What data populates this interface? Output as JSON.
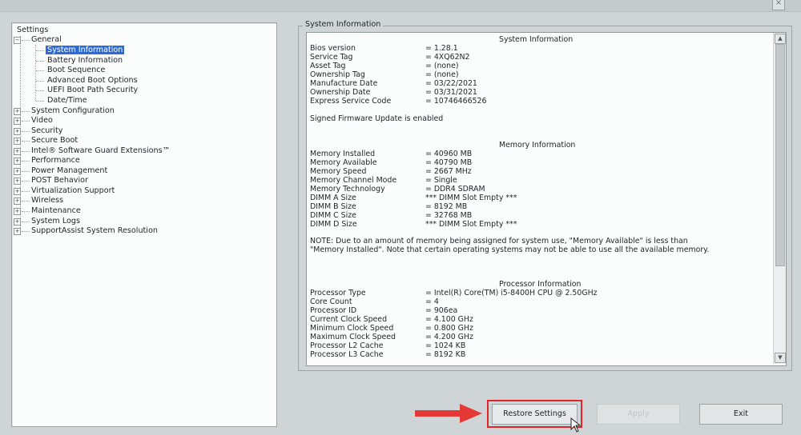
{
  "window": {
    "title": "",
    "close_symbol": "×"
  },
  "tree": {
    "root": "Settings",
    "general": {
      "label": "General",
      "children": [
        "System Information",
        "Battery Information",
        "Boot Sequence",
        "Advanced Boot Options",
        "UEFI Boot Path Security",
        "Date/Time"
      ]
    },
    "categories": [
      "System Configuration",
      "Video",
      "Security",
      "Secure Boot",
      "Intel® Software Guard Extensions™",
      "Performance",
      "Power Management",
      "POST Behavior",
      "Virtualization Support",
      "Wireless",
      "Maintenance",
      "System Logs",
      "SupportAssist System Resolution"
    ]
  },
  "panel": {
    "group_label": "System Information",
    "system": {
      "title": "System Information",
      "rows": [
        {
          "k": "Bios version",
          "v": "= 1.28.1"
        },
        {
          "k": "Service Tag",
          "v": "= 4XQ62N2"
        },
        {
          "k": "Asset Tag",
          "v": "= (none)"
        },
        {
          "k": "Ownership Tag",
          "v": "= (none)"
        },
        {
          "k": "Manufacture Date",
          "v": "= 03/22/2021"
        },
        {
          "k": "Ownership Date",
          "v": "= 03/31/2021"
        },
        {
          "k": "Express Service Code",
          "v": "= 10746466526"
        }
      ],
      "firmware_note": "Signed Firmware Update is enabled"
    },
    "memory": {
      "title": "Memory Information",
      "rows": [
        {
          "k": "Memory Installed",
          "v": "= 40960 MB"
        },
        {
          "k": "Memory Available",
          "v": "= 40790 MB"
        },
        {
          "k": "Memory Speed",
          "v": "= 2667 MHz"
        },
        {
          "k": "Memory Channel Mode",
          "v": "= Single"
        },
        {
          "k": "Memory Technology",
          "v": "= DDR4 SDRAM"
        },
        {
          "k": "DIMM A Size",
          "v": "*** DIMM Slot Empty ***"
        },
        {
          "k": "DIMM B Size",
          "v": "= 8192 MB"
        },
        {
          "k": "DIMM C Size",
          "v": "= 32768 MB"
        },
        {
          "k": "DIMM D Size",
          "v": "*** DIMM Slot Empty ***"
        }
      ],
      "note": "NOTE: Due to an amount of memory being assigned for system use, \"Memory Available\" is less than \"Memory Installed\". Note that certain operating systems may not be able to use all the available memory."
    },
    "processor": {
      "title": "Processor Information",
      "rows": [
        {
          "k": "Processor Type",
          "v": "= Intel(R) Core(TM) i5-8400H CPU @ 2.50GHz"
        },
        {
          "k": "Core Count",
          "v": "= 4"
        },
        {
          "k": "Processor ID",
          "v": "= 906ea"
        },
        {
          "k": "Current Clock Speed",
          "v": "= 4.100 GHz"
        },
        {
          "k": "Minimum Clock Speed",
          "v": "= 0.800 GHz"
        },
        {
          "k": "Maximum Clock Speed",
          "v": "= 4.200 GHz"
        },
        {
          "k": "Processor L2 Cache",
          "v": "= 1024 KB"
        },
        {
          "k": "Processor L3 Cache",
          "v": "= 8192 KB"
        }
      ]
    }
  },
  "buttons": {
    "restore": "Restore Settings",
    "apply": "Apply",
    "exit": "Exit"
  },
  "colors": {
    "selection": "#2d6bd5",
    "highlight": "#e0242a",
    "arrow": "#e53935"
  }
}
